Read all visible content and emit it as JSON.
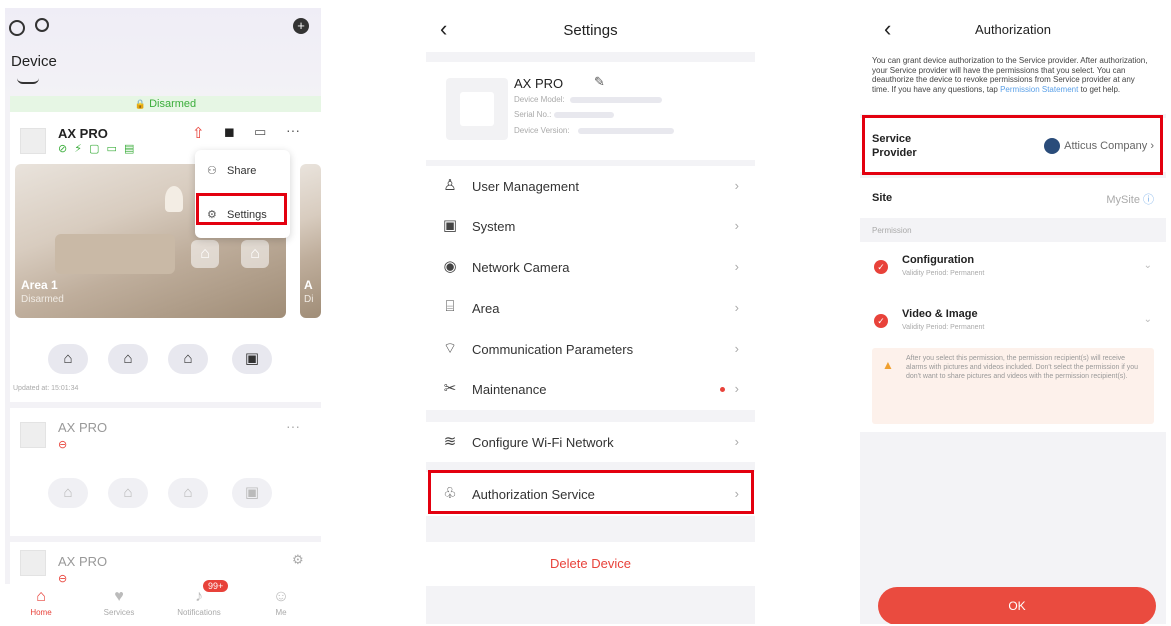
{
  "panel1": {
    "title": "Device",
    "arm_status": "Disarmed",
    "device1": {
      "name": "AX PRO",
      "status_icons": "⊘ ⚡ ▢ ▭ ▤"
    },
    "area": {
      "name": "Area 1",
      "status": "Disarmed",
      "next_area_initial": "A",
      "next_area_status": "Di"
    },
    "popup": {
      "share": "Share",
      "settings": "Settings"
    },
    "updated": "Updated at: 15:01:34",
    "device2": {
      "name": "AX PRO"
    },
    "device3": {
      "name": "AX PRO"
    },
    "tabs": [
      {
        "label": "Home"
      },
      {
        "label": "Services"
      },
      {
        "label": "Notifications",
        "badge": "99+"
      },
      {
        "label": "Me"
      }
    ]
  },
  "panel2": {
    "title": "Settings",
    "device_name": "AX PRO",
    "meta_model": "Device Model:",
    "meta_serial": "Serial No.:",
    "meta_version": "Device Version:",
    "menu": [
      {
        "label": "User Management",
        "icon": "user-icon"
      },
      {
        "label": "System",
        "icon": "system-icon"
      },
      {
        "label": "Network Camera",
        "icon": "camera-icon"
      },
      {
        "label": "Area",
        "icon": "area-icon"
      },
      {
        "label": "Communication Parameters",
        "icon": "antenna-icon"
      },
      {
        "label": "Maintenance",
        "icon": "wrench-icon"
      }
    ],
    "wifi": "Configure Wi-Fi Network",
    "auth": "Authorization Service",
    "delete": "Delete Device"
  },
  "panel3": {
    "title": "Authorization",
    "intro_1": "You can grant device authorization to the Service provider. After authorization, your Service provider will have the permissions that you select. You can deauthorize the device to revoke permissions from Service provider at any time. If you have any questions, tap ",
    "intro_link": "Permission Statement",
    "intro_2": " to get help.",
    "service_provider_label_1": "Service",
    "service_provider_label_2": "Provider",
    "service_provider_value": "Atticus Company",
    "site_label": "Site",
    "site_value": "MySite",
    "permission_header": "Permission",
    "perm1": {
      "name": "Configuration",
      "sub": "Validity Period: Permanent"
    },
    "perm2": {
      "name": "Video & Image",
      "sub": "Validity Period: Permanent"
    },
    "warning": "After you select this permission, the permission recipient(s) will receive alarms with pictures and videos included. Don't select the permission if you don't want to share pictures and videos with the permission recipient(s).",
    "ok": "OK"
  },
  "colors": {
    "accent": "#e8423a",
    "highlight": "#e3000f",
    "armed_green": "#3cae3c"
  }
}
